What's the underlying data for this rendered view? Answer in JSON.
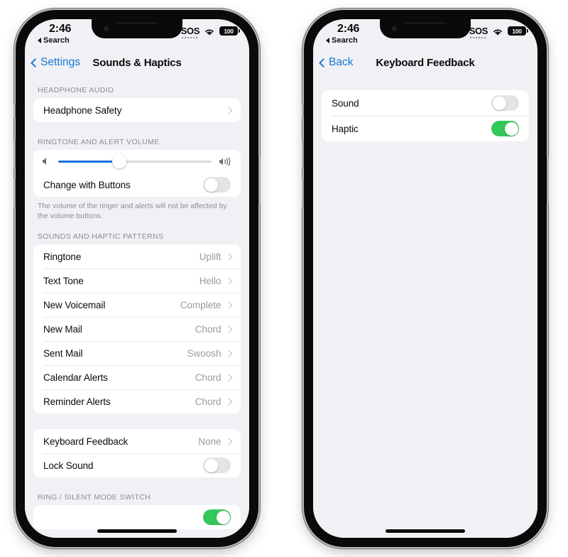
{
  "colors": {
    "accent_blue": "#1579d6",
    "slider_blue": "#1a6fe0",
    "toggle_on_green": "#34c759",
    "screen_bg": "#f1f1f5",
    "card_bg": "#ffffff",
    "secondary_text": "#9a9a9f",
    "header_text": "#8c8c91"
  },
  "phones": [
    {
      "id": "left",
      "status_bar": {
        "time": "2:46",
        "back_indicator": "Search",
        "sos_label": "SOS",
        "wifi_icon": "wifi-icon",
        "battery_level": "100"
      },
      "nav": {
        "back_label": "Settings",
        "title": "Sounds & Haptics"
      },
      "sections": [
        {
          "header": "HEADPHONE AUDIO",
          "rows": [
            {
              "label": "Headphone Safety",
              "type": "disclosure",
              "value": ""
            }
          ]
        },
        {
          "header": "RINGTONE AND ALERT VOLUME",
          "slider": {
            "left_icon": "speaker-mute-icon",
            "right_icon": "speaker-loud-icon",
            "value_percent": 40
          },
          "rows": [
            {
              "label": "Change with Buttons",
              "type": "toggle",
              "on": false
            }
          ],
          "footnote": "The volume of the ringer and alerts will not be affected by the volume buttons."
        },
        {
          "header": "SOUNDS AND HAPTIC PATTERNS",
          "rows": [
            {
              "label": "Ringtone",
              "type": "disclosure",
              "value": "Uplift"
            },
            {
              "label": "Text Tone",
              "type": "disclosure",
              "value": "Hello"
            },
            {
              "label": "New Voicemail",
              "type": "disclosure",
              "value": "Complete"
            },
            {
              "label": "New Mail",
              "type": "disclosure",
              "value": "Chord"
            },
            {
              "label": "Sent Mail",
              "type": "disclosure",
              "value": "Swoosh"
            },
            {
              "label": "Calendar Alerts",
              "type": "disclosure",
              "value": "Chord"
            },
            {
              "label": "Reminder Alerts",
              "type": "disclosure",
              "value": "Chord"
            }
          ]
        },
        {
          "header": "",
          "rows": [
            {
              "label": "Keyboard Feedback",
              "type": "disclosure",
              "value": "None"
            },
            {
              "label": "Lock Sound",
              "type": "toggle",
              "on": false
            }
          ]
        },
        {
          "header": "RING / SILENT MODE SWITCH",
          "rows": [
            {
              "label": "",
              "type": "toggle",
              "on": true
            }
          ]
        }
      ]
    },
    {
      "id": "right",
      "status_bar": {
        "time": "2:46",
        "back_indicator": "Search",
        "sos_label": "SOS",
        "wifi_icon": "wifi-icon",
        "battery_level": "100"
      },
      "nav": {
        "back_label": "Back",
        "title": "Keyboard Feedback"
      },
      "sections": [
        {
          "header": "",
          "rows": [
            {
              "label": "Sound",
              "type": "toggle",
              "on": false
            },
            {
              "label": "Haptic",
              "type": "toggle",
              "on": true
            }
          ]
        }
      ]
    }
  ]
}
